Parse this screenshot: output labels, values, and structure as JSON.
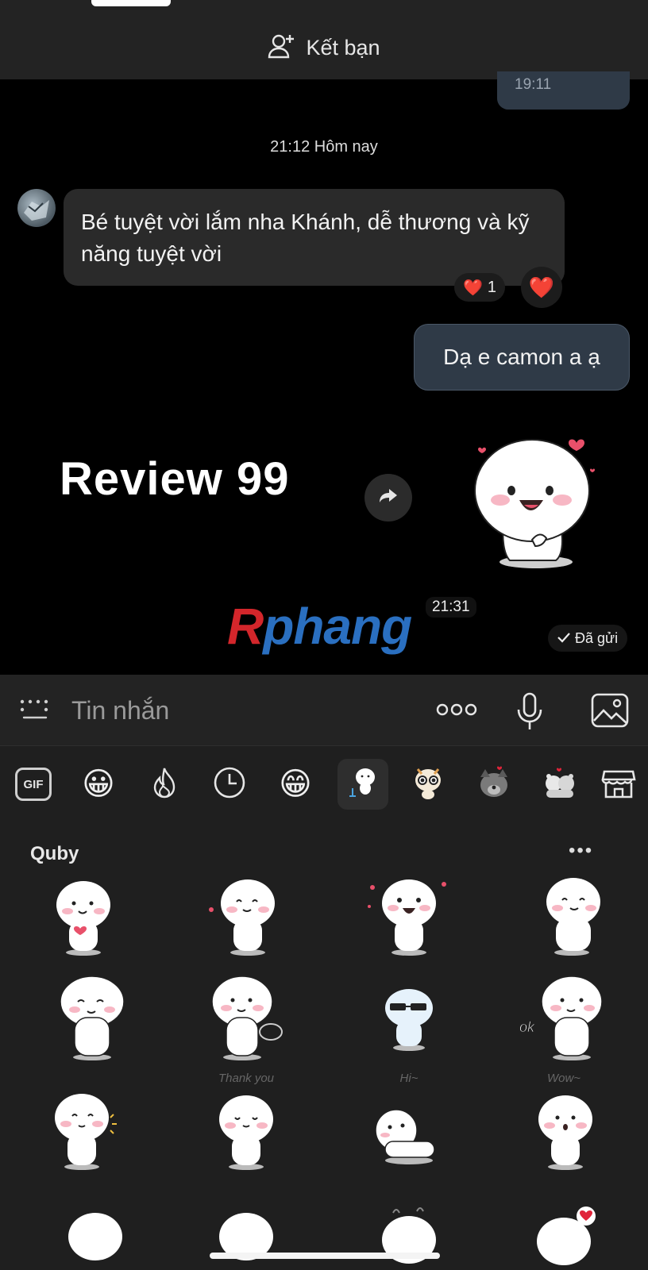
{
  "header": {
    "add_friend_label": "Kết bạn"
  },
  "chat": {
    "previous_message_time": "19:11",
    "date_separator": "21:12 Hôm nay",
    "incoming_message": "Bé tuyệt vời lắm nha Khánh, dễ thương và kỹ năng tuyệt vời",
    "reaction": {
      "emoji": "❤️",
      "count": "1"
    },
    "reaction_button_emoji": "❤️",
    "outgoing_message": "Dạ e camon a ạ",
    "overlay_text": "Review 99",
    "sticker_time": "21:31",
    "sent_status": "Đã gửi",
    "watermark": {
      "first_letter": "R",
      "rest": "phang"
    }
  },
  "input": {
    "placeholder": "Tin nhắn",
    "more_label": "ooo"
  },
  "sticker_panel": {
    "tabs": [
      {
        "name": "gif",
        "label": "GIF"
      },
      {
        "name": "emoji-smile",
        "label": "😀"
      },
      {
        "name": "trending",
        "icon": "flame-icon"
      },
      {
        "name": "recent",
        "icon": "clock-icon"
      },
      {
        "name": "emoji-grin",
        "label": "😁"
      },
      {
        "name": "quby-pack",
        "icon": "quby-icon",
        "active": true
      },
      {
        "name": "pack-2",
        "icon": "sticker-icon"
      },
      {
        "name": "pack-3",
        "icon": "dog-icon"
      },
      {
        "name": "pack-4",
        "icon": "bears-icon"
      },
      {
        "name": "store",
        "icon": "store-icon"
      }
    ],
    "pack_title": "Quby",
    "more_label": "•••",
    "sticker_captions": [
      "Thank you",
      "Hi~",
      "Wow~"
    ],
    "ok_label": "ok"
  },
  "colors": {
    "bubble_incoming": "#2a2a2a",
    "bubble_outgoing": "#2f3a47",
    "panel_bg": "#1f1f1f",
    "heart": "#e0243a"
  }
}
